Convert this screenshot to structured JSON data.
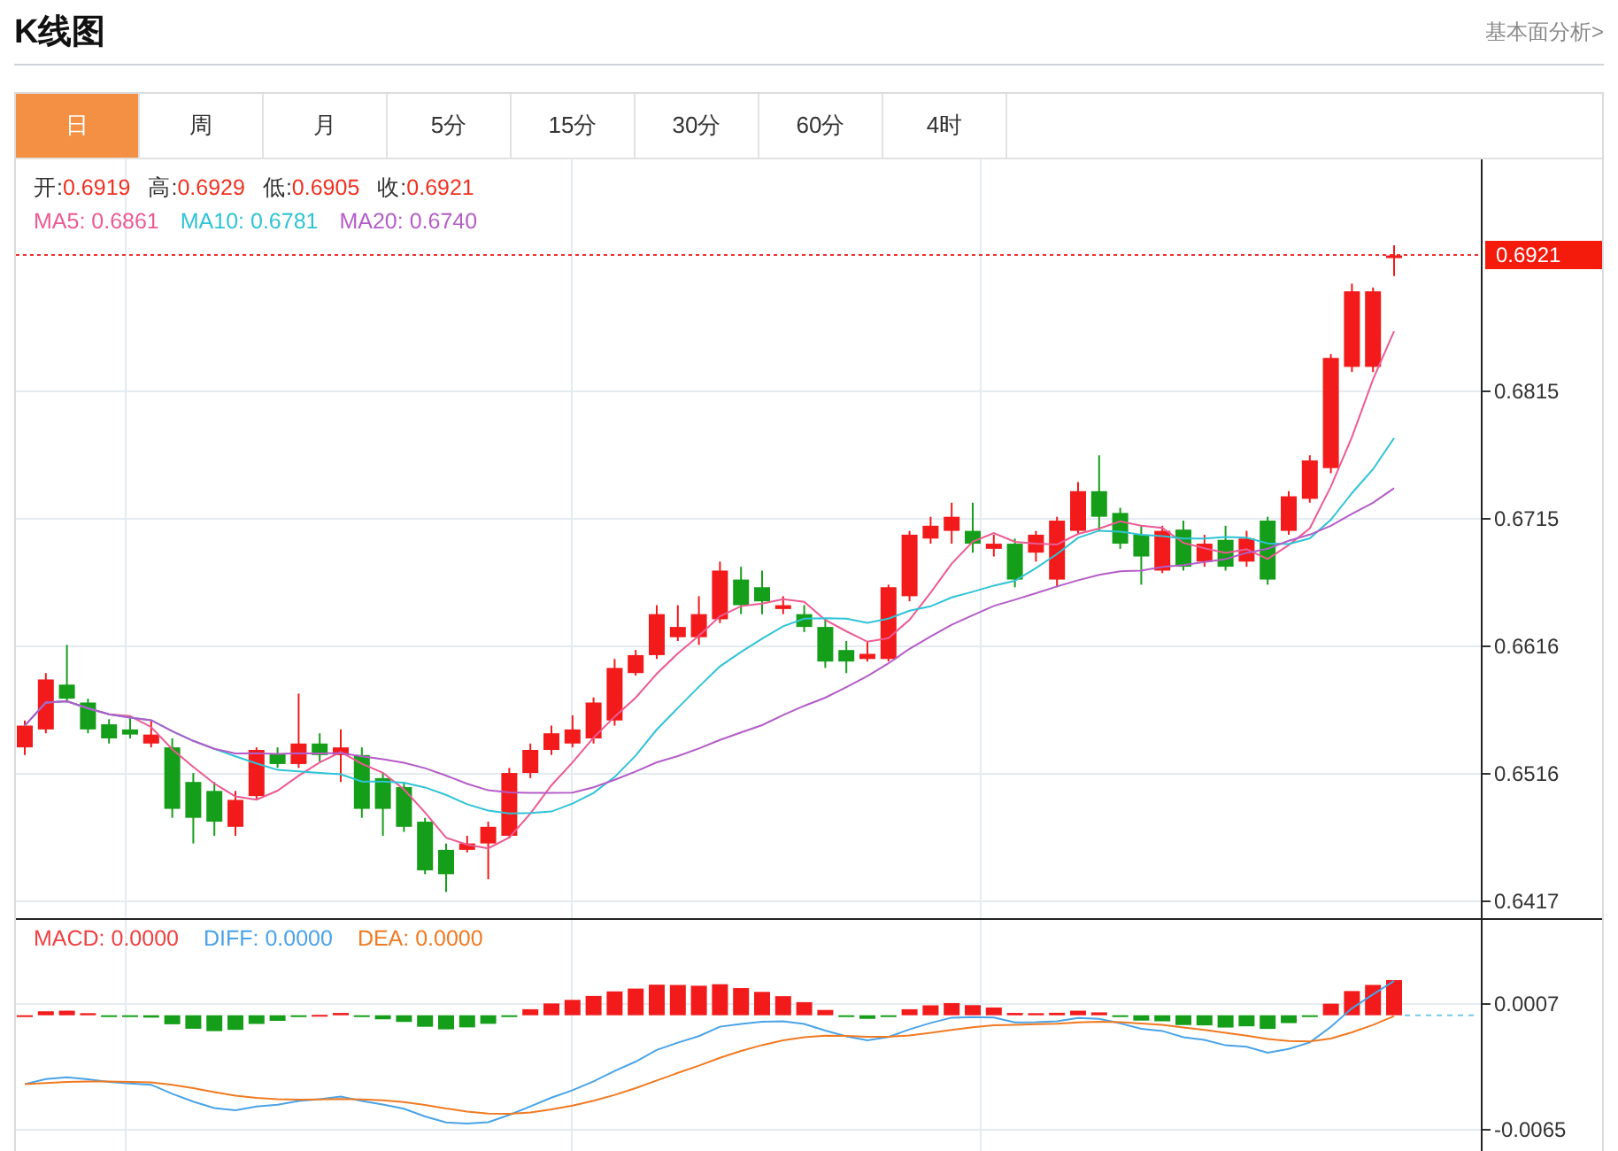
{
  "header": {
    "title": "K线图",
    "link": "基本面分析>"
  },
  "tabs": [
    {
      "label": "日",
      "selected": true
    },
    {
      "label": "周",
      "selected": false
    },
    {
      "label": "月",
      "selected": false
    },
    {
      "label": "5分",
      "selected": false
    },
    {
      "label": "15分",
      "selected": false
    },
    {
      "label": "30分",
      "selected": false
    },
    {
      "label": "60分",
      "selected": false
    },
    {
      "label": "4时",
      "selected": false
    }
  ],
  "chart": {
    "quote": [
      {
        "label": "开:",
        "value": "0.6919"
      },
      {
        "label": "高:",
        "value": "0.6929"
      },
      {
        "label": "低:",
        "value": "0.6905"
      },
      {
        "label": "收:",
        "value": "0.6921"
      }
    ],
    "ma": [
      {
        "label": "MA5: 0.6861",
        "color": "#ec5a93"
      },
      {
        "label": "MA10: 0.6781",
        "color": "#2fc3d6"
      },
      {
        "label": "MA20: 0.6740",
        "color": "#b45cc8"
      }
    ],
    "last_price": "0.6921",
    "price_axis": [
      "0.6815",
      "0.6715",
      "0.6616",
      "0.6516",
      "0.6417"
    ]
  },
  "macd": {
    "legend": [
      {
        "label": "MACD: 0.0000",
        "color": "#f04040"
      },
      {
        "label": "DIFF: 0.0000",
        "color": "#4aa3e8"
      },
      {
        "label": "DEA: 0.0000",
        "color": "#f07a22"
      }
    ],
    "axis": [
      "0.0007",
      "-0.0065"
    ]
  }
}
